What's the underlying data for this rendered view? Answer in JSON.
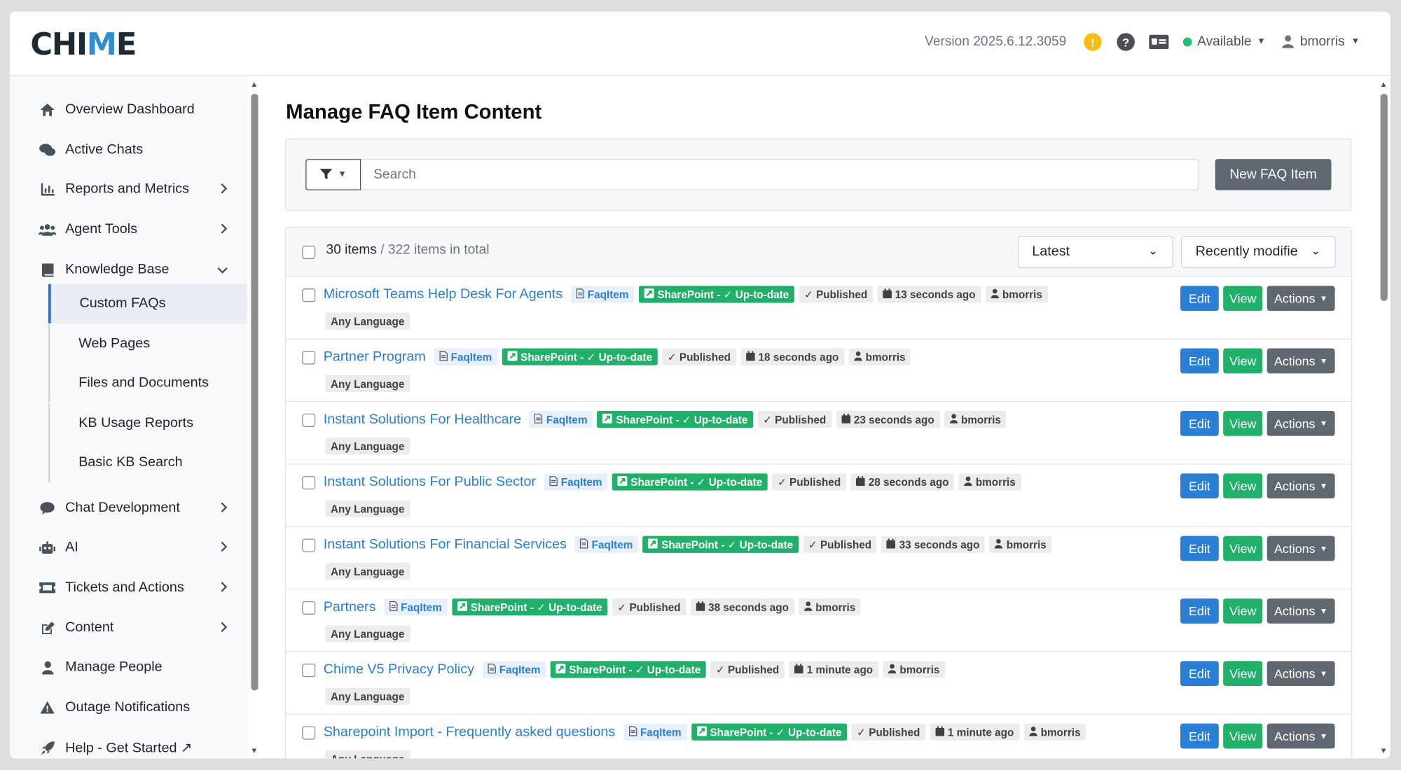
{
  "header": {
    "logo": {
      "prefix": "CHI",
      "accent": "M",
      "suffix": "E"
    },
    "version": "Version 2025.6.12.3059",
    "status": "Available",
    "user": "bmorris"
  },
  "sidebar": {
    "items": [
      {
        "label": "Overview Dashboard",
        "icon": "home-icon"
      },
      {
        "label": "Active Chats",
        "icon": "chats-icon"
      },
      {
        "label": "Reports and Metrics",
        "icon": "chart-icon"
      },
      {
        "label": "Agent Tools",
        "icon": "users-icon"
      },
      {
        "label": "Knowledge Base",
        "icon": "book-icon"
      },
      {
        "label": "Chat Development",
        "icon": "comment-icon"
      },
      {
        "label": "AI",
        "icon": "robot-icon"
      },
      {
        "label": "Tickets and Actions",
        "icon": "ticket-icon"
      },
      {
        "label": "Content",
        "icon": "edit-icon"
      },
      {
        "label": "Manage People",
        "icon": "person-icon"
      },
      {
        "label": "Outage Notifications",
        "icon": "warning-icon"
      },
      {
        "label": "Help - Get Started ↗",
        "icon": "rocket-icon"
      }
    ],
    "kb_sub": [
      "Custom FAQs",
      "Web Pages",
      "Files and Documents",
      "KB Usage Reports",
      "Basic KB Search"
    ]
  },
  "main": {
    "title": "Manage FAQ Item Content",
    "search_placeholder": "Search",
    "new_button": "New FAQ Item",
    "count": "30 items",
    "total": " / 322 items in total",
    "sort1": "Latest",
    "sort2": "Recently modifie",
    "btn_edit": "Edit",
    "btn_view": "View",
    "btn_actions": "Actions",
    "rows": [
      {
        "title": "Microsoft Teams Help Desk For Agents",
        "type": "FaqItem",
        "source": "SharePoint - ✓ Up-to-date",
        "status": "✓ Published",
        "time": "13 seconds ago",
        "user": "bmorris",
        "lang": "Any Language"
      },
      {
        "title": "Partner Program",
        "type": "FaqItem",
        "source": "SharePoint - ✓ Up-to-date",
        "status": "✓ Published",
        "time": "18 seconds ago",
        "user": "bmorris",
        "lang": "Any Language"
      },
      {
        "title": "Instant Solutions For Healthcare",
        "type": "FaqItem",
        "source": "SharePoint - ✓ Up-to-date",
        "status": "✓ Published",
        "time": "23 seconds ago",
        "user": "bmorris",
        "lang": "Any Language"
      },
      {
        "title": "Instant Solutions For Public Sector",
        "type": "FaqItem",
        "source": "SharePoint - ✓ Up-to-date",
        "status": "✓ Published",
        "time": "28 seconds ago",
        "user": "bmorris",
        "lang": "Any Language"
      },
      {
        "title": "Instant Solutions For Financial Services",
        "type": "FaqItem",
        "source": "SharePoint - ✓ Up-to-date",
        "status": "✓ Published",
        "time": "33 seconds ago",
        "user": "bmorris",
        "lang": "Any Language"
      },
      {
        "title": "Partners",
        "type": "FaqItem",
        "source": "SharePoint - ✓ Up-to-date",
        "status": "✓ Published",
        "time": "38 seconds ago",
        "user": "bmorris",
        "lang": "Any Language"
      },
      {
        "title": "Chime V5 Privacy Policy",
        "type": "FaqItem",
        "source": "SharePoint - ✓ Up-to-date",
        "status": "✓ Published",
        "time": "1 minute ago",
        "user": "bmorris",
        "lang": "Any Language"
      },
      {
        "title": "Sharepoint Import - Frequently asked questions",
        "type": "FaqItem",
        "source": "SharePoint - ✓ Up-to-date",
        "status": "✓ Published",
        "time": "1 minute ago",
        "user": "bmorris",
        "lang": "Any Language"
      }
    ]
  },
  "colors": {
    "accent_blue": "#2a7fd4",
    "success_green": "#20b06a",
    "secondary_grey": "#5f6870",
    "warning": "#f6bd16"
  }
}
